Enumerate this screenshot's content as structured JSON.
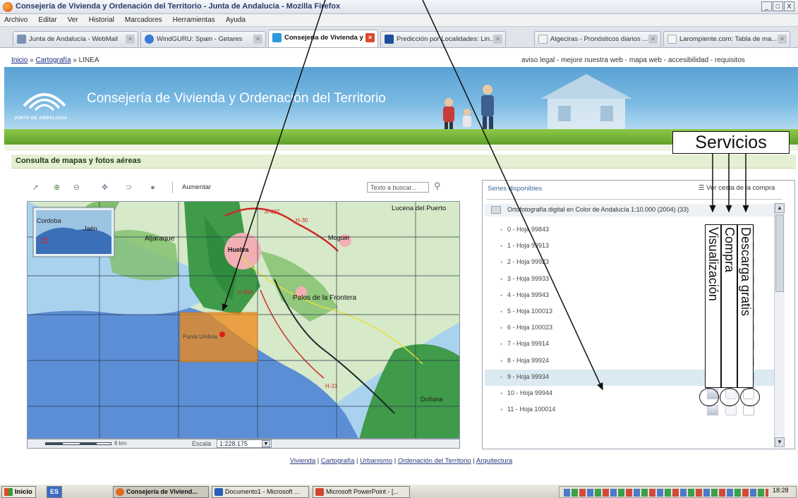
{
  "window": {
    "title": "Consejería de Vivienda y Ordenación del Territorio - Junta de Andalucia - Mozilla Firefox",
    "min": "_",
    "max": "□",
    "close": "X"
  },
  "menu": [
    "Archivo",
    "Editar",
    "Ver",
    "Historial",
    "Marcadores",
    "Herramientas",
    "Ayuda"
  ],
  "tabs": [
    {
      "label": "Junta de Andalucía - WebMail",
      "color": "#7b93b3"
    },
    {
      "label": "WindGURU: Spain - Getares",
      "color": "#3a7bd5"
    },
    {
      "label": "Consejería de Vivienda y ...",
      "color": "#2a9bd9",
      "active": true
    },
    {
      "label": "Predicción por Localidades: Lin...",
      "color": "#1d4f9c"
    },
    {
      "label": "Algeciras - Pronósticos diarios ...",
      "color": "#e7e7e7"
    },
    {
      "label": "Larompiente.com: Tabla de ma...",
      "color": "#e7e7e7"
    }
  ],
  "breadcrumb": {
    "inicio": "Inicio",
    "sep1": " » ",
    "cartografia": "Cartografía",
    "sep2": " » ",
    "linea": "LINEA"
  },
  "toplinks": "aviso legal - mejore nuestra web - mapa web - accesibilidad - requisitos",
  "banner": {
    "title": "Consejería de Vivienda y Ordenación del Territorio",
    "logo_text": "JUNTA DE ANDALUCIA"
  },
  "section": {
    "title": "Consulta de mapas y fotos aéreas"
  },
  "map_toolbar": {
    "aumentar": "Aumentar",
    "search_placeholder": "Texto a buscar..."
  },
  "map": {
    "places": [
      "Cordoba",
      "Jaén",
      "Aljaraque",
      "Huelva",
      "Moguer",
      "Lucena del Puerto",
      "Palos de la Frontera",
      "Punta Umbria",
      "Doñana"
    ],
    "roads": [
      "A-497",
      "H-30",
      "A-494",
      "H-31"
    ],
    "scale_label": "Escala",
    "scale_value": "1:228.175",
    "scale_km": "8 km"
  },
  "panel": {
    "series_title": "Series disponibles",
    "cesta": "Ver cesta de la compra",
    "group": "Ortofotografía digital en Color de Andalucía 1:10.000 (2004)  (33)",
    "rows": [
      "0 - Hoja 99843",
      "1 - Hoja 99913",
      "2 - Hoja 99923",
      "3 - Hoja 99933",
      "4 - Hoja 99943",
      "5 - Hoja 100013",
      "6 - Hoja 100023",
      "7 - Hoja 99914",
      "8 - Hoja 99924",
      "9 - Hoja 99934",
      "10 - Hoja 99944",
      "11 - Hoja 100014"
    ]
  },
  "annotations": {
    "servicios": "Servicios",
    "visualizacion": "Visualización",
    "compra": "Compra",
    "descarga": "Descarga gratis"
  },
  "footer": {
    "vivienda": "Vivienda",
    "cartografia": "Cartografía",
    "urbanismo": "Urbanismo",
    "ordenacion": "Ordenación del Territorio",
    "arquitectura": "Arquitectura",
    "sep": " | "
  },
  "taskbar": {
    "start": "Inicio",
    "es": "ES",
    "buttons": [
      {
        "label": "Consejería de Viviend...",
        "active": true
      },
      {
        "label": "Documento1 - Microsoft ..."
      },
      {
        "label": "Microsoft PowerPoint - [..."
      }
    ],
    "clock": "18:28"
  }
}
